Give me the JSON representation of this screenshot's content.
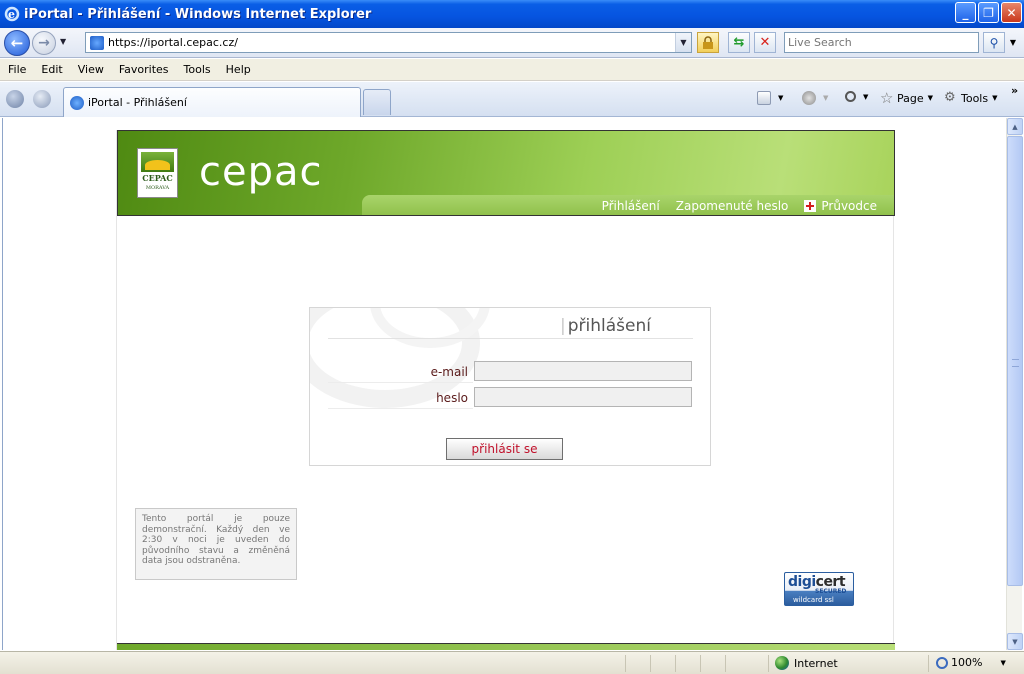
{
  "window": {
    "title": "iPortal - Přihlášení - Windows Internet Explorer",
    "buttons": {
      "minimize": "_",
      "restore": "❐",
      "close": "✕"
    }
  },
  "address": {
    "url": "https://iportal.cepac.cz/",
    "search_placeholder": "Live Search"
  },
  "menu": [
    "File",
    "Edit",
    "View",
    "Favorites",
    "Tools",
    "Help"
  ],
  "tab": {
    "label": "iPortal - Přihlášení"
  },
  "commands": {
    "page": "Page",
    "tools": "Tools"
  },
  "site": {
    "brand": "cepac",
    "logo_text": "CEPAC",
    "logo_subtext": "MORAVA",
    "nav": [
      "Přihlášení",
      "Zapomenuté heslo",
      "Průvodce"
    ]
  },
  "login": {
    "title": "přihlášení",
    "email_label": "e-mail",
    "email_value": "",
    "password_label": "heslo",
    "password_value": "",
    "submit_label": "přihlásit se"
  },
  "notice": "Tento portál je pouze demonstrační. Každý den ve 2:30 v noci je uveden do původního stavu a změněná data jsou odstraněna.",
  "digicert": {
    "name_a": "digi",
    "name_b": "cert",
    "line1": "SECURED",
    "line2": "wildcard ssl"
  },
  "status": {
    "zone": "Internet",
    "zoom": "100%"
  },
  "colors": {
    "header_green": "#6ea82a",
    "login_button_text": "#c0102a",
    "titlebar_blue": "#0654e0"
  }
}
